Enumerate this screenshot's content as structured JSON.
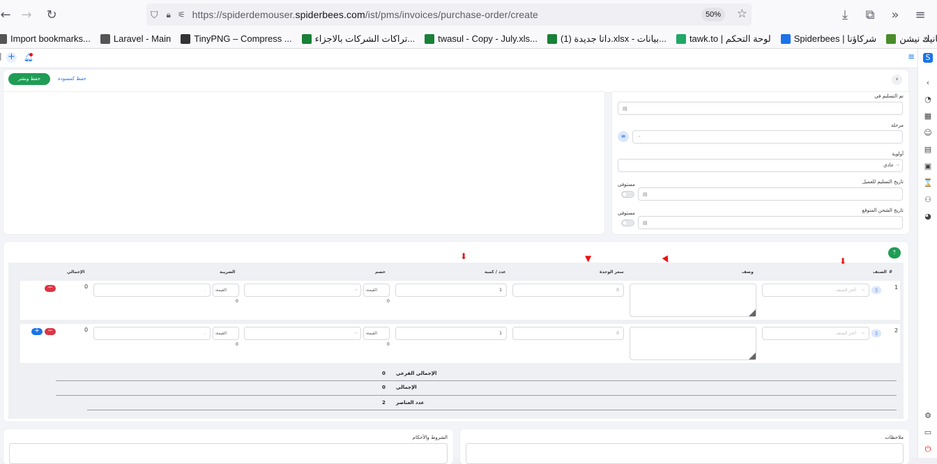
{
  "browser": {
    "url_prefix": "https://spiderdemouser.",
    "url_domain": "spiderbees.com",
    "url_path": "/ist/pms/invoices/purchase-order/create",
    "zoom": "50%",
    "bookmarks": [
      {
        "label": "Import bookmarks...",
        "icon": "folder-icon",
        "color": "#555"
      },
      {
        "label": "Laravel - Main",
        "icon": "globe-icon",
        "color": "#555"
      },
      {
        "label": "TinyPNG – Compress ...",
        "icon": "panda-icon",
        "color": "#333"
      },
      {
        "label": "تراكات الشركات بالاجزاء...",
        "icon": "sheets-icon",
        "color": "#188038"
      },
      {
        "label": "twasul - Copy - July.xls...",
        "icon": "sheets-icon",
        "color": "#188038"
      },
      {
        "label": "داتا جديدة (1).xlsx - بيانات...",
        "icon": "sheets-icon",
        "color": "#188038"
      },
      {
        "label": "tawk.to | لوحة التحكم",
        "icon": "tawk-icon",
        "color": "#1fa866"
      },
      {
        "label": "Spiderbees | شركاؤنا",
        "icon": "spiderbees-icon",
        "color": "#1a73e8"
      },
      {
        "label": "الحمراء – اورجانيك نيشن ...",
        "icon": "frog-icon",
        "color": "#4a8c2a"
      }
    ]
  },
  "header": {
    "save_publish": "حفظ ونشر",
    "save_draft": "حفظ كمسودة"
  },
  "form": {
    "delivered_in_label": "تم التسليم في",
    "stage_label": "مرحلة",
    "stage_value": "-",
    "priority_label": "أولوية",
    "priority_value": "عادي",
    "client_delivery_label": "تاريخ التسليم للعميل",
    "expected_ship_label": "تاريخ الشحن المتوقع",
    "fulfilled_label": "مستوفى"
  },
  "table": {
    "headers": {
      "num": "#",
      "item": "الصنف",
      "desc": "وصف",
      "unit_price": "سعر الوحدة",
      "qty": "عدد / كمية",
      "discount": "خصم",
      "tax": "الضريبة",
      "total": "الإجمالي"
    },
    "rows": [
      {
        "num": "1",
        "item_placeholder": "أختر الصنف",
        "price": "0",
        "qty": "1",
        "discount_type": "القيمة",
        "discount_sub": "0",
        "tax_type": "القيمة",
        "tax_sub": "0",
        "total": "0"
      },
      {
        "num": "2",
        "item_placeholder": "أختر الصنف",
        "price": "0",
        "qty": "1",
        "discount_type": "القيمة",
        "discount_sub": "0",
        "tax_type": "القيمة",
        "tax_sub": "0",
        "total": "0"
      }
    ]
  },
  "summary": {
    "subtotal_label": "الإجمالي الفرعي",
    "subtotal_value": "0",
    "total_label": "الإجمالي",
    "total_value": "0",
    "items_count_label": "عدد العناصر",
    "items_count_value": "2"
  },
  "bottom": {
    "terms_label": "الشروط والأحكام",
    "notes_label": "ملاحظات"
  }
}
